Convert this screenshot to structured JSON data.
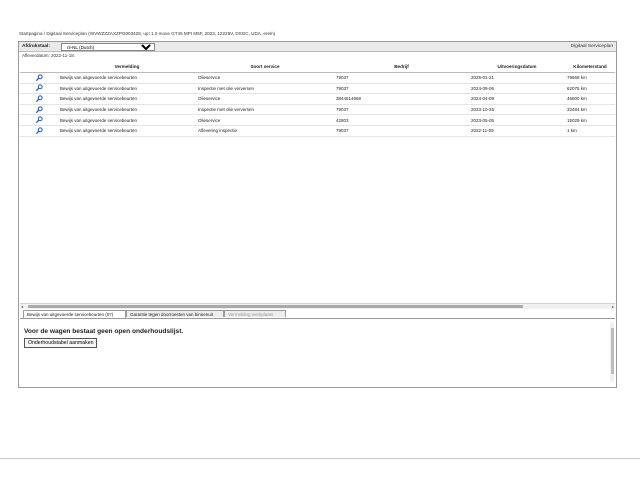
{
  "breadcrumb": "Startpagina / Digitaal Serviceplan (WVWZZZAXZPG003428, up! 1.0 move GT45 MPI M5F, 2023, 12228V, DSGC, UDA, ereln)",
  "toolbar": {
    "label": "Afdrukstaal:",
    "language_value": "nl-NL (Dutch)",
    "title": "Digitaal Serviceplan"
  },
  "delivery_date": "Afleverdatum: 2022-11-18.",
  "table": {
    "columns": [
      "",
      "Vermelding",
      "Soort service",
      "Bedrijf",
      "Uitvoeringsdatum",
      "Kilometerstand"
    ],
    "rows": [
      {
        "icon": "magnifier-icon",
        "vermelding": "Bewijs van uitgevoerde servicebeurten",
        "soort": "Olieservice",
        "bedrijf": "79037",
        "datum": "2025-01-21",
        "km": "79668 km"
      },
      {
        "icon": "magnifier-icon",
        "vermelding": "Bewijs van uitgevoerde servicebeurten",
        "soort": "Inspectie met olie verversen",
        "bedrijf": "79037",
        "datum": "2024-09-06",
        "km": "62075 km"
      },
      {
        "icon": "magnifier-icon",
        "vermelding": "Bewijs van uitgevoerde servicebeurten",
        "soort": "Olieservice",
        "bedrijf": "3844614668",
        "datum": "2024-04-09",
        "km": "46600 km"
      },
      {
        "icon": "magnifier-icon",
        "vermelding": "Bewijs van uitgevoerde servicebeurten",
        "soort": "Inspectie met olie verversen",
        "bedrijf": "79037",
        "datum": "2023-10-26",
        "km": "32484 km"
      },
      {
        "icon": "magnifier-icon",
        "vermelding": "Bewijs van uitgevoerde servicebeurten",
        "soort": "Olieservice",
        "bedrijf": "42803",
        "datum": "2023-05-05",
        "km": "15029 km"
      },
      {
        "icon": "magnifier-icon",
        "vermelding": "Bewijs van uitgevoerde servicebeurten",
        "soort": "Aflevering inspectie",
        "bedrijf": "79037",
        "datum": "2022-11-09",
        "km": "1 km"
      }
    ]
  },
  "tabs": [
    {
      "label": "Bewijs van uitgevoerde servicebeurten (07)",
      "state": "active"
    },
    {
      "label": "Garantie tegen doorroesten van binnenuit",
      "state": "normal"
    },
    {
      "label": "Vermelding werkplaats",
      "state": "disabled"
    }
  ],
  "lower": {
    "message": "Voor de wagen bestaat geen open onderhoudslijst.",
    "button_label": "Onderhoudstabel aanmaken"
  },
  "colors": {
    "accent": "#1a5aa6",
    "border": "#9a9a9a"
  }
}
